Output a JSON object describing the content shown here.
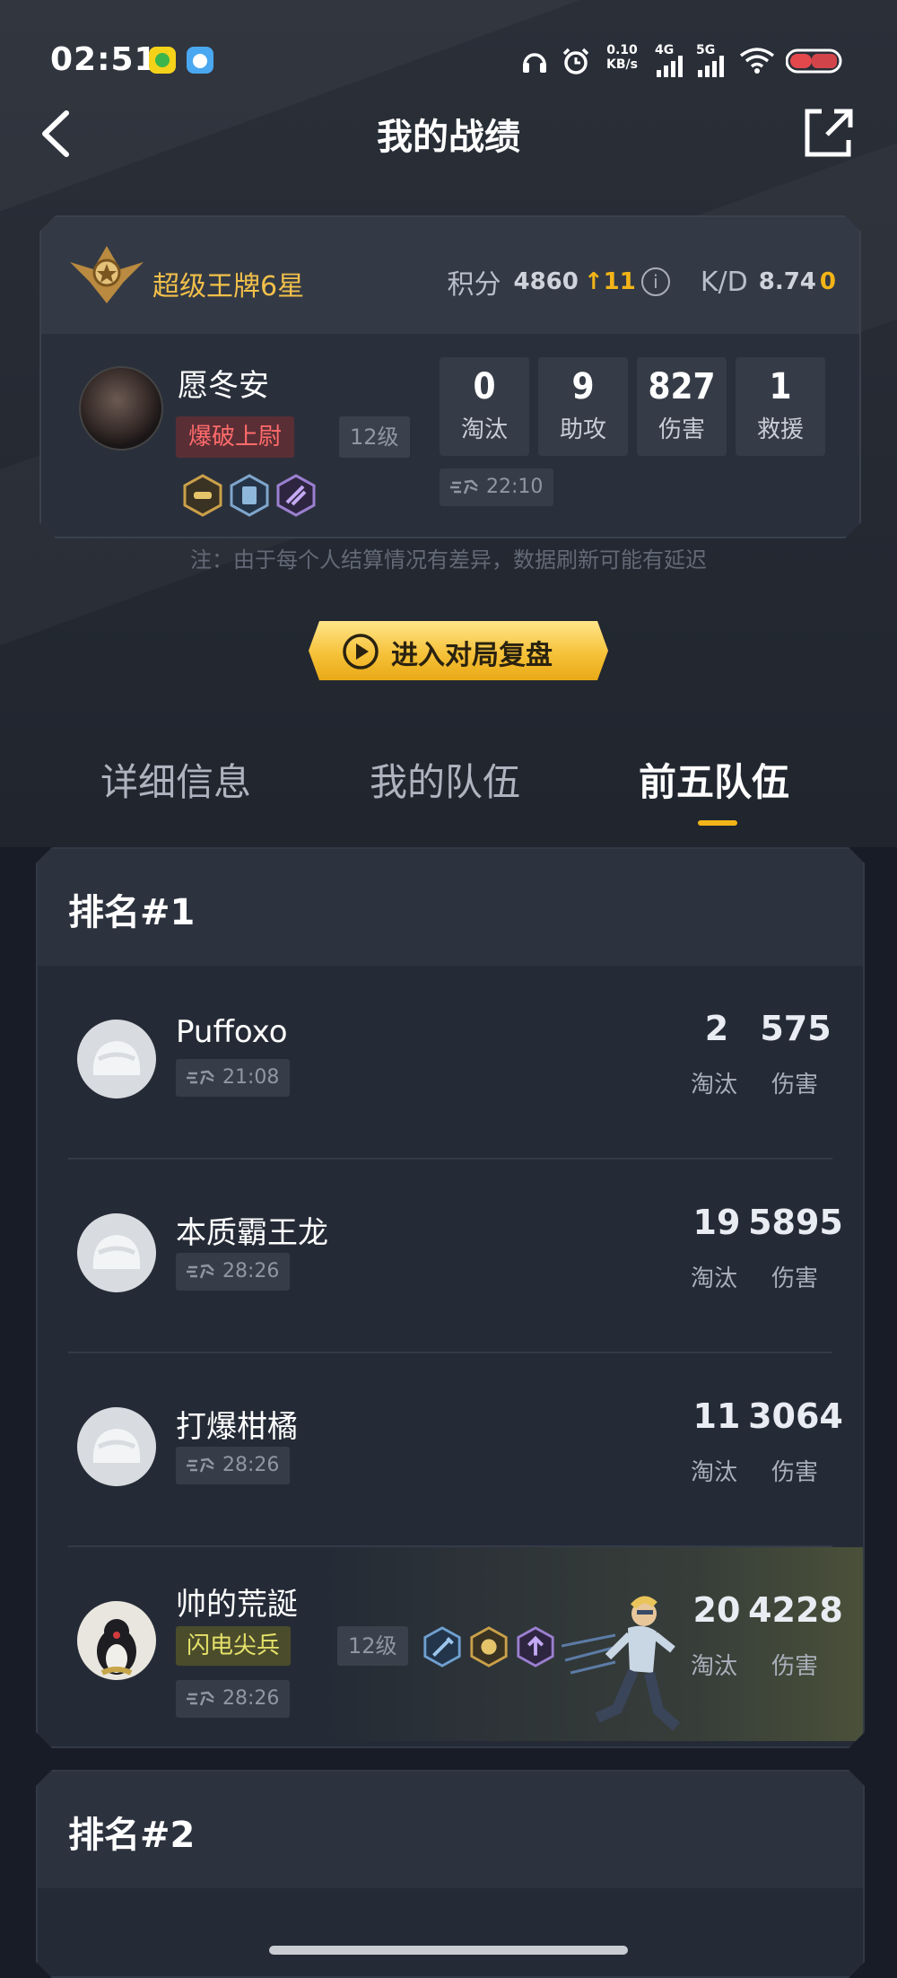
{
  "status": {
    "time": "02:51",
    "net_speed_value": "0.10",
    "net_speed_unit": "KB/s",
    "signal1": "4G",
    "signal2": "5G"
  },
  "nav": {
    "title": "我的战绩"
  },
  "my_card": {
    "rank_name": "超级王牌6星",
    "score_label": "积分",
    "score_value": "4860",
    "score_change": "11",
    "kd_label": "K/D",
    "kd_value": "8.74",
    "kd_suffix": "0",
    "player_name": "愿冬安",
    "title_badge": "爆破上尉",
    "level": "12级",
    "stats": [
      {
        "value": "0",
        "label": "淘汰"
      },
      {
        "value": "9",
        "label": "助攻"
      },
      {
        "value": "827",
        "label": "伤害"
      },
      {
        "value": "1",
        "label": "救援"
      }
    ],
    "survival_time": "22:10"
  },
  "note": "注：由于每个人结算情况有差异，数据刷新可能有延迟",
  "replay_button": "进入对局复盘",
  "tabs": [
    "详细信息",
    "我的队伍",
    "前五队伍"
  ],
  "active_tab": "前五队伍",
  "ranks": [
    {
      "title": "排名#1",
      "players": [
        {
          "name": "Puffoxo",
          "time": "21:08",
          "kills": "2",
          "damage": "575"
        },
        {
          "name": "本质霸王龙",
          "time": "28:26",
          "kills": "19",
          "damage": "5895"
        },
        {
          "name": "打爆柑橘",
          "time": "28:26",
          "kills": "11",
          "damage": "3064"
        },
        {
          "name": "帅的荒誕",
          "title_badge": "闪电尖兵",
          "level": "12级",
          "time": "28:26",
          "kills": "20",
          "damage": "4228"
        }
      ]
    },
    {
      "title": "排名#2"
    }
  ],
  "labels": {
    "kills": "淘汰",
    "damage": "伤害"
  },
  "colors": {
    "accent": "#f2b418",
    "rank_gold": "#f2c04a",
    "background": "#171c27"
  }
}
